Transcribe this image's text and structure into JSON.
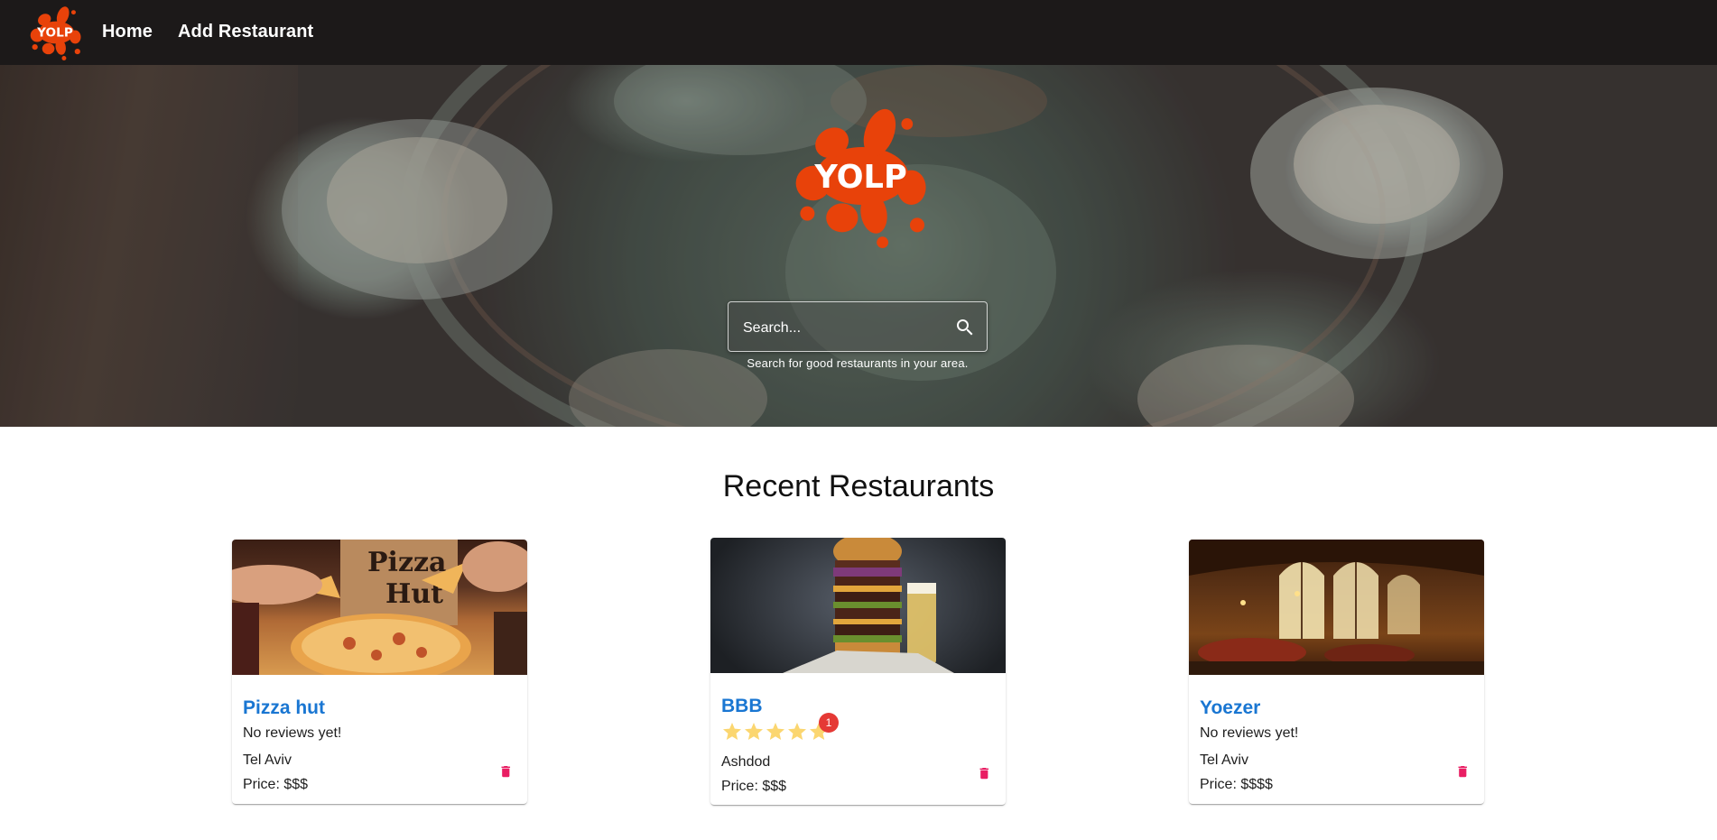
{
  "navbar": {
    "brand_logo": "yolp-logo",
    "links": [
      "Home",
      "Add Restaurant"
    ]
  },
  "hero": {
    "logo": "yolp-logo",
    "logo_text": "YOLP",
    "search": {
      "placeholder": "Search...",
      "icon": "search-icon",
      "helper": "Search for good restaurants in your area."
    }
  },
  "recent": {
    "title": "Recent Restaurants",
    "restaurants": [
      {
        "name": "Pizza hut",
        "reviews": "No reviews yet!",
        "city": "Tel Aviv",
        "price": "Price: $$$"
      },
      {
        "name": "BBB",
        "rating": 5,
        "review_count": "1",
        "city": "Ashdod",
        "price": "Price: $$$"
      },
      {
        "name": "Yoezer",
        "reviews": "No reviews yet!",
        "city": "Tel Aviv",
        "price": "Price: $$$$"
      }
    ]
  },
  "colors": {
    "navbar": "#1c1919",
    "brand_orange": "#e8420a",
    "link_blue": "#1976d2",
    "delete_pink": "#e91e63",
    "star_yellow": "#fbd670",
    "badge_red": "#e53935"
  },
  "icons": {
    "delete": "trash-icon",
    "star": "star-icon"
  }
}
